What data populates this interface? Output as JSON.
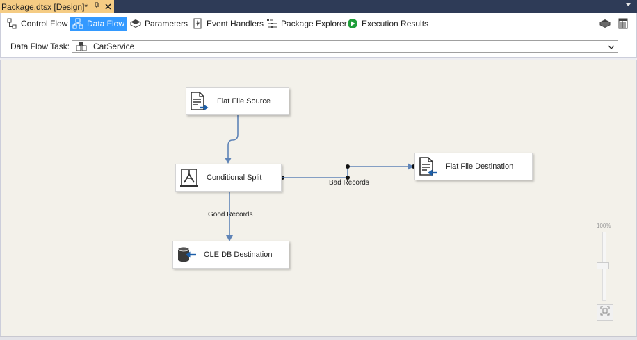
{
  "document_tab": {
    "title": "Package.dtsx [Design]*",
    "pin_icon": "pin-icon",
    "close_icon": "close-icon"
  },
  "designer_tabs": [
    {
      "label": "Control Flow",
      "icon": "control-flow-icon",
      "active": false
    },
    {
      "label": "Data Flow",
      "icon": "data-flow-icon",
      "active": true
    },
    {
      "label": "Parameters",
      "icon": "parameters-icon",
      "active": false
    },
    {
      "label": "Event Handlers",
      "icon": "event-handlers-icon",
      "active": false
    },
    {
      "label": "Package Explorer",
      "icon": "package-explorer-icon",
      "active": false
    },
    {
      "label": "Execution Results",
      "icon": "execution-results-icon",
      "active": false
    }
  ],
  "task_selector": {
    "label": "Data Flow Task:",
    "value": "CarService"
  },
  "components": {
    "flat_file_source": "Flat File Source",
    "conditional_split": "Conditional Split",
    "flat_file_destination": "Flat File Destination",
    "ole_db_destination": "OLE DB Destination"
  },
  "paths": {
    "bad_records": "Bad Records",
    "good_records": "Good Records"
  },
  "zoom": {
    "percent_label": "100%",
    "level": 1.0
  },
  "colors": {
    "active_tab": "#3399ff",
    "doc_tab": "#f5cc84",
    "canvas": "#f3f1ea",
    "wire": "#5f84b7",
    "icon_blue": "#1d5fa9"
  }
}
